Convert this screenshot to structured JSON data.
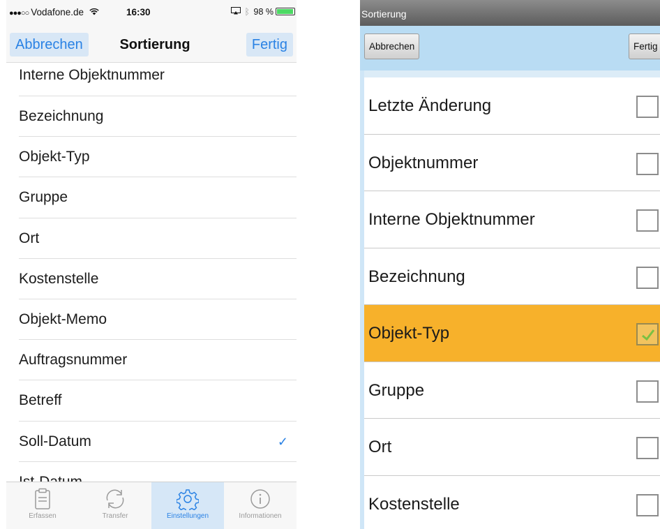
{
  "ios": {
    "status": {
      "carrier": "Vodafone.de",
      "time": "16:30",
      "battery": "98 %"
    },
    "nav": {
      "cancel_label": "Abbrechen",
      "title": "Sortierung",
      "done_label": "Fertig"
    },
    "items": [
      {
        "label": "Interne Objektnummer",
        "checked": false
      },
      {
        "label": "Bezeichnung",
        "checked": false
      },
      {
        "label": "Objekt-Typ",
        "checked": false
      },
      {
        "label": "Gruppe",
        "checked": false
      },
      {
        "label": "Ort",
        "checked": false
      },
      {
        "label": "Kostenstelle",
        "checked": false
      },
      {
        "label": "Objekt-Memo",
        "checked": false
      },
      {
        "label": "Auftragsnummer",
        "checked": false
      },
      {
        "label": "Betreff",
        "checked": false
      },
      {
        "label": "Soll-Datum",
        "checked": true
      },
      {
        "label": "Ist-Datum",
        "checked": false
      }
    ],
    "check_mark": "✓",
    "tabs": [
      {
        "label": "Erfassen",
        "icon": "clipboard-icon",
        "active": false
      },
      {
        "label": "Transfer",
        "icon": "sync-icon",
        "active": false
      },
      {
        "label": "Einstellungen",
        "icon": "gear-icon",
        "active": true
      },
      {
        "label": "Informationen",
        "icon": "info-icon",
        "active": false
      }
    ],
    "colors": {
      "accent": "#2a82e4",
      "active_tab_bg": "#d6e7f7"
    }
  },
  "android": {
    "title": "Sortierung",
    "cancel_label": "Abbrechen",
    "done_label": "Fertig",
    "items": [
      {
        "label": "Letzte Änderung",
        "checked": false,
        "selected": false
      },
      {
        "label": "Objektnummer",
        "checked": false,
        "selected": false
      },
      {
        "label": "Interne Objektnummer",
        "checked": false,
        "selected": false
      },
      {
        "label": "Bezeichnung",
        "checked": false,
        "selected": false
      },
      {
        "label": "Objekt-Typ",
        "checked": true,
        "selected": true
      },
      {
        "label": "Gruppe",
        "checked": false,
        "selected": false
      },
      {
        "label": "Ort",
        "checked": false,
        "selected": false
      },
      {
        "label": "Kostenstelle",
        "checked": false,
        "selected": false
      }
    ],
    "colors": {
      "toolbar": "#b9dcf3",
      "selected_row": "#f7b12b",
      "check": "#7bc043"
    }
  }
}
